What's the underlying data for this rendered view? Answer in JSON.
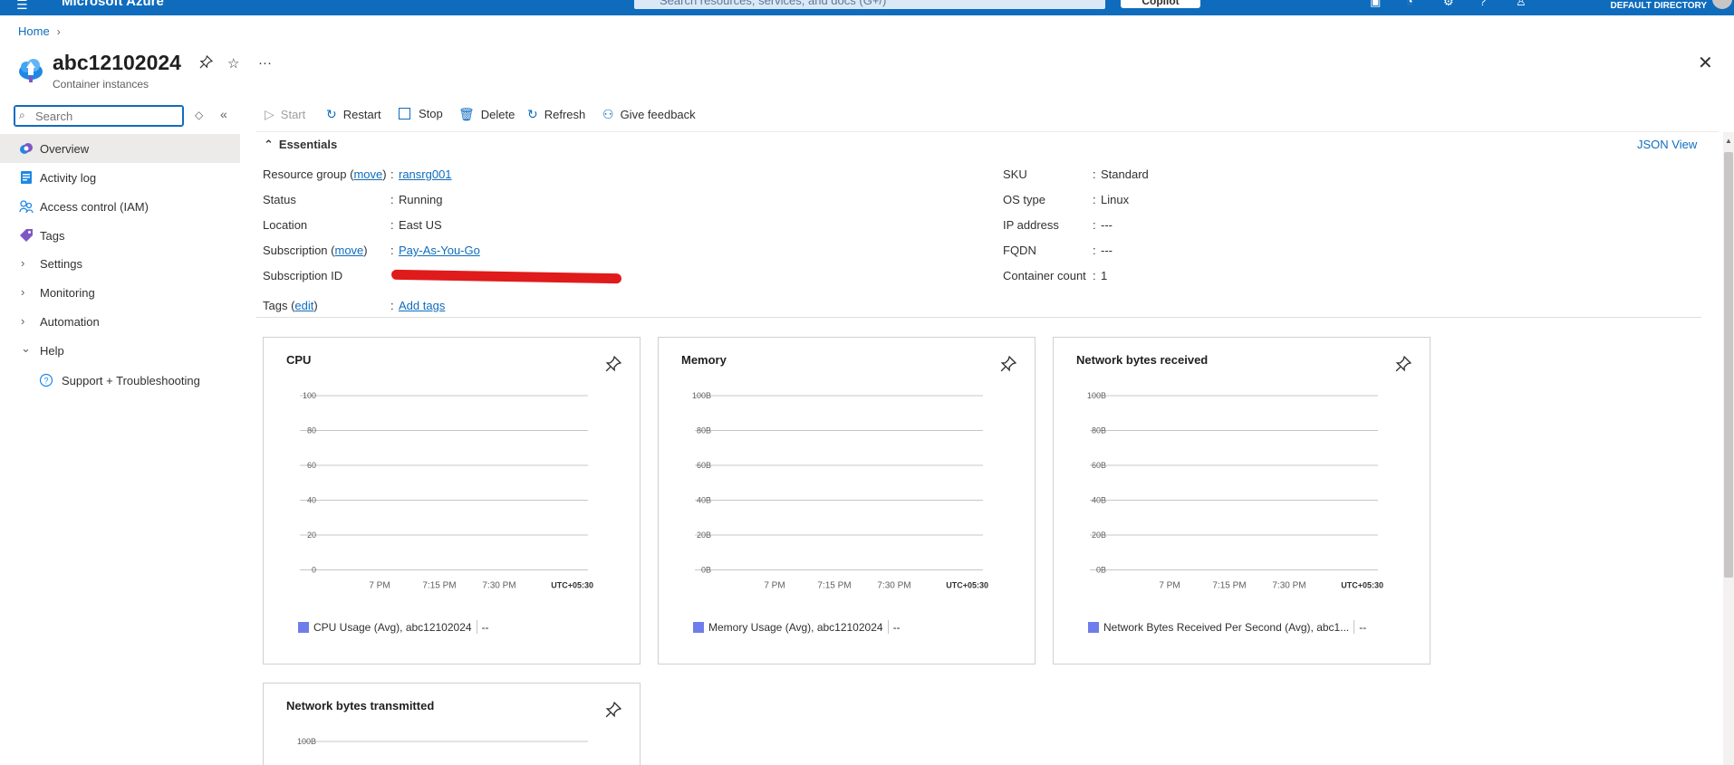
{
  "topbar": {
    "brand": "Microsoft Azure",
    "search_placeholder": "Search resources, services, and docs (G+/)",
    "copilot": "Copilot",
    "directory": "DEFAULT DIRECTORY"
  },
  "breadcrumb": {
    "home": "Home"
  },
  "resource": {
    "name": "abc12102024",
    "type": "Container instances"
  },
  "sidebar": {
    "search_placeholder": "Search",
    "items": [
      {
        "label": "Overview"
      },
      {
        "label": "Activity log"
      },
      {
        "label": "Access control (IAM)"
      },
      {
        "label": "Tags"
      },
      {
        "label": "Settings"
      },
      {
        "label": "Monitoring"
      },
      {
        "label": "Automation"
      },
      {
        "label": "Help"
      },
      {
        "label": "Support + Troubleshooting"
      }
    ]
  },
  "commands": {
    "start": "Start",
    "restart": "Restart",
    "stop": "Stop",
    "delete": "Delete",
    "refresh": "Refresh",
    "feedback": "Give feedback"
  },
  "essentials": {
    "title": "Essentials",
    "json_view": "JSON View",
    "left": {
      "resource_group_label": "Resource group",
      "move": "move",
      "resource_group_value": "ransrg001",
      "status_label": "Status",
      "status_value": "Running",
      "location_label": "Location",
      "location_value": "East US",
      "subscription_label": "Subscription",
      "subscription_value": "Pay-As-You-Go",
      "subscription_id_label": "Subscription ID",
      "tags_label": "Tags",
      "edit": "edit",
      "tags_value": "Add tags"
    },
    "right": {
      "sku_label": "SKU",
      "sku_value": "Standard",
      "os_label": "OS type",
      "os_value": "Linux",
      "ip_label": "IP address",
      "ip_value": "---",
      "fqdn_label": "FQDN",
      "fqdn_value": "---",
      "count_label": "Container count",
      "count_value": "1"
    }
  },
  "tiles": [
    {
      "title": "CPU",
      "legend": "CPU Usage (Avg), abc12102024",
      "legend_value": "--"
    },
    {
      "title": "Memory",
      "legend": "Memory Usage (Avg), abc12102024",
      "legend_value": "--"
    },
    {
      "title": "Network bytes received",
      "legend": "Network Bytes Received Per Second (Avg), abc1...",
      "legend_value": "--"
    },
    {
      "title": "Network bytes transmitted"
    }
  ],
  "colors": {
    "accent": "#0f6cbd",
    "series": "#6f7dea",
    "redaction": "#e01b1b"
  },
  "chart_data": [
    {
      "type": "line",
      "title": "CPU",
      "y_ticks": [
        "100",
        "80",
        "60",
        "40",
        "20",
        "0"
      ],
      "x_ticks": [
        "7 PM",
        "7:15 PM",
        "7:30 PM"
      ],
      "timezone": "UTC+05:30",
      "ylim": [
        0,
        100
      ],
      "series": []
    },
    {
      "type": "line",
      "title": "Memory",
      "y_ticks": [
        "100B",
        "80B",
        "60B",
        "40B",
        "20B",
        "0B"
      ],
      "x_ticks": [
        "7 PM",
        "7:15 PM",
        "7:30 PM"
      ],
      "timezone": "UTC+05:30",
      "series": []
    },
    {
      "type": "line",
      "title": "Network bytes received",
      "y_ticks": [
        "100B",
        "80B",
        "60B",
        "40B",
        "20B",
        "0B"
      ],
      "x_ticks": [
        "7 PM",
        "7:15 PM",
        "7:30 PM"
      ],
      "timezone": "UTC+05:30",
      "series": []
    },
    {
      "type": "line",
      "title": "Network bytes transmitted",
      "y_ticks": [
        "100B"
      ],
      "series": []
    }
  ]
}
